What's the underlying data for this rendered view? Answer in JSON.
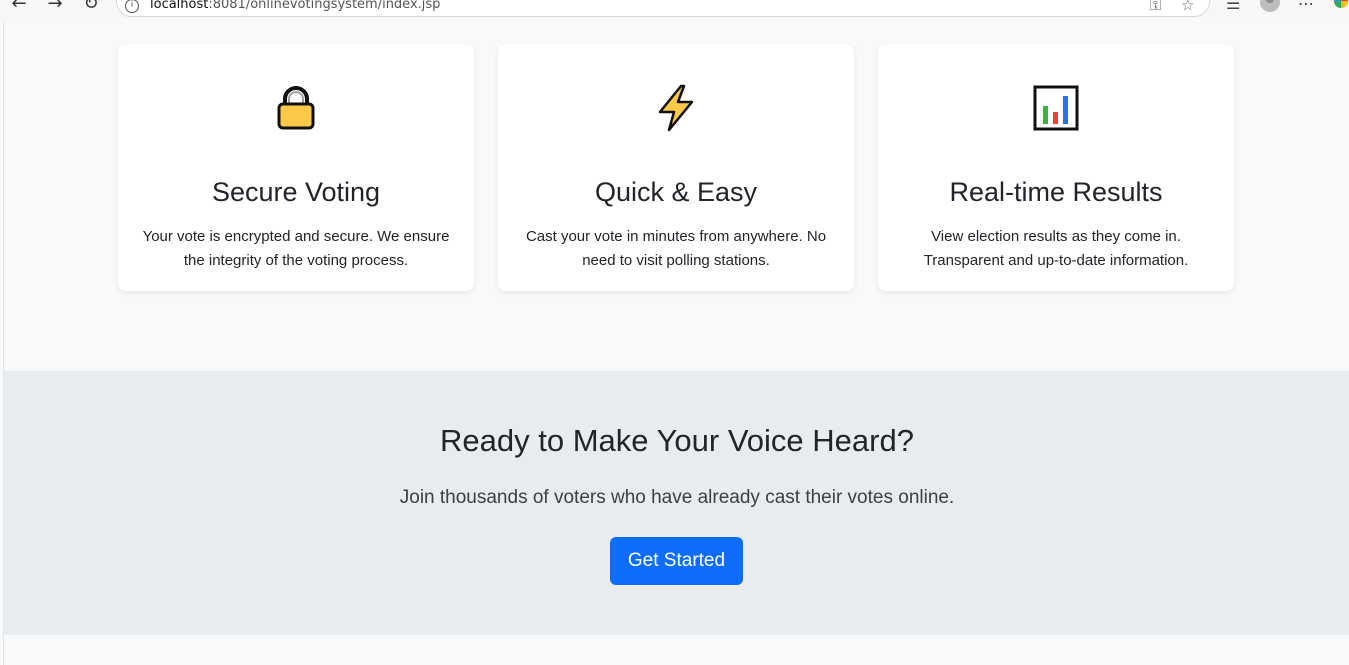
{
  "browser": {
    "url_host": "localhost",
    "url_path": ":8081/onlinevotingsystem/index.jsp",
    "back_icon": "arrow-left-icon",
    "forward_icon": "arrow-right-icon",
    "reload_icon": "reload-icon"
  },
  "features": [
    {
      "icon": "lock-icon",
      "title": "Secure Voting",
      "text": "Your vote is encrypted and secure. We ensure the integrity of the voting process."
    },
    {
      "icon": "lightning-icon",
      "title": "Quick & Easy",
      "text": "Cast your vote in minutes from anywhere. No need to visit polling stations."
    },
    {
      "icon": "bar-chart-icon",
      "title": "Real-time Results",
      "text": "View election results as they come in. Transparent and up-to-date information."
    }
  ],
  "cta": {
    "title": "Ready to Make Your Voice Heard?",
    "text": "Join thousands of voters who have already cast their votes online.",
    "button_label": "Get Started"
  },
  "colors": {
    "primary": "#0d6efd",
    "page_bg": "#f8f9fa",
    "cta_bg": "#e9ecef"
  }
}
